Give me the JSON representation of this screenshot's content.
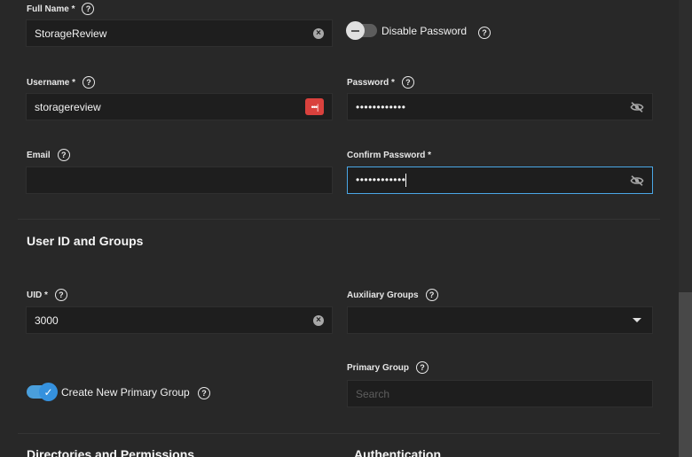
{
  "fields": {
    "full_name": {
      "label": "Full Name *",
      "value": "StorageReview"
    },
    "disable_password": {
      "label": "Disable Password"
    },
    "username": {
      "label": "Username *",
      "value": "storagereview",
      "pw_manager_glyph": "•••|"
    },
    "password": {
      "label": "Password *",
      "value": "••••••••••••"
    },
    "email": {
      "label": "Email",
      "value": ""
    },
    "confirm_password": {
      "label": "Confirm Password *",
      "value": "••••••••••••"
    }
  },
  "sections": {
    "user_id_groups": "User ID and Groups",
    "directories": "Directories and Permissions",
    "authentication": "Authentication"
  },
  "uid": {
    "label": "UID *",
    "value": "3000"
  },
  "auxiliary_groups": {
    "label": "Auxiliary Groups",
    "value": ""
  },
  "create_primary_group": {
    "label": "Create New Primary Group"
  },
  "primary_group": {
    "label": "Primary Group",
    "placeholder": "Search"
  },
  "glyphs": {
    "help": "?",
    "clear": "×",
    "check": "✓"
  },
  "colors": {
    "accent": "#4aa7e6",
    "password_manager": "#d9413d",
    "background": "#282828",
    "field": "#1e1e1e"
  },
  "icons": {
    "help": "help-circle-icon",
    "clear": "clear-circle-icon",
    "visibility": "eye-off-icon",
    "password_manager": "password-manager-icon",
    "dropdown": "caret-down-icon"
  }
}
